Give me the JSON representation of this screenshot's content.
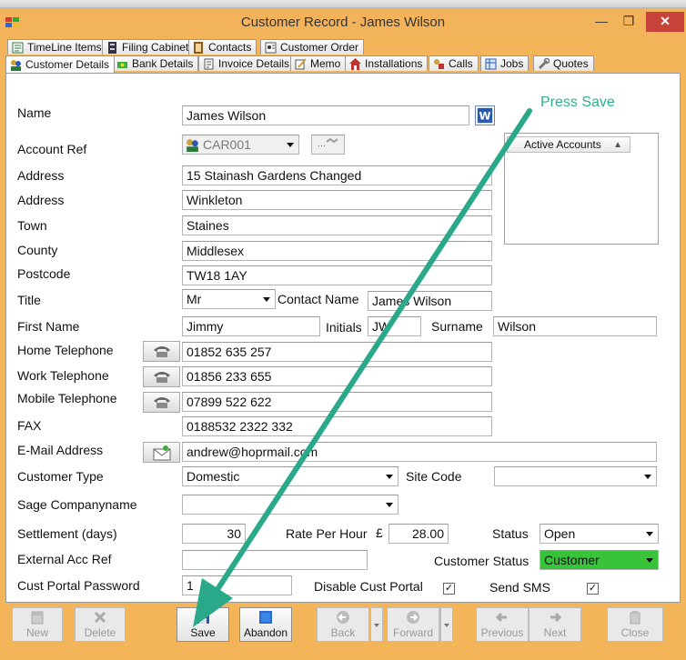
{
  "window": {
    "title": "Customer Record - James Wilson",
    "min_glyph": "—",
    "max_glyph": "❐",
    "close_glyph": "✕"
  },
  "tabs_row1": [
    {
      "label": "TimeLine Items",
      "icon": "timeline-icon"
    },
    {
      "label": "Filing Cabinet",
      "icon": "filing-cabinet-icon"
    },
    {
      "label": "Contacts",
      "icon": "contacts-icon"
    },
    {
      "label": "Customer Order",
      "icon": "customer-order-icon"
    }
  ],
  "tabs_row2": [
    {
      "label": "Customer Details",
      "icon": "customer-details-icon",
      "active": true
    },
    {
      "label": "Bank Details",
      "icon": "bank-details-icon"
    },
    {
      "label": "Invoice Details",
      "icon": "invoice-details-icon"
    },
    {
      "label": "Memo",
      "icon": "memo-icon"
    },
    {
      "label": "Installations",
      "icon": "installations-icon"
    },
    {
      "label": "Calls",
      "icon": "calls-icon"
    },
    {
      "label": "Jobs",
      "icon": "jobs-icon"
    },
    {
      "label": "Quotes",
      "icon": "quotes-icon"
    }
  ],
  "form": {
    "name_label": "Name",
    "name_value": "James Wilson",
    "account_ref_label": "Account Ref",
    "account_ref_value": "CAR001",
    "lookup_button_label": "...",
    "address1_label": "Address",
    "address1_value": "15 Stainash Gardens Changed",
    "address2_label": "Address",
    "address2_value": "Winkleton",
    "town_label": "Town",
    "town_value": "Staines",
    "county_label": "County",
    "county_value": "Middlesex",
    "postcode_label": "Postcode",
    "postcode_value": "TW18 1AY",
    "title_label": "Title",
    "title_value": "Mr",
    "contact_name_label": "Contact Name",
    "contact_name_value": "James Wilson",
    "first_name_label": "First Name",
    "first_name_value": "Jimmy",
    "initials_label": "Initials",
    "initials_value": "JW",
    "surname_label": "Surname",
    "surname_value": "Wilson",
    "home_tel_label": "Home Telephone",
    "home_tel_value": "01852 635 257",
    "work_tel_label": "Work Telephone",
    "work_tel_value": "01856 233 655",
    "mobile_tel_label": "Mobile Telephone",
    "mobile_tel_value": "07899 522 622",
    "fax_label": "FAX",
    "fax_value": "0188532 2322 332",
    "email_label": "E-Mail Address",
    "email_value": "andrew@hoprmail.com",
    "customer_type_label": "Customer  Type",
    "customer_type_value": "Domestic",
    "site_code_label": "Site Code",
    "site_code_value": "",
    "sage_company_label": "Sage Companyname",
    "sage_company_value": "",
    "settlement_label": "Settlement (days)",
    "settlement_value": "30",
    "rate_per_hour_label": "Rate Per Hour",
    "currency_symbol": "£",
    "rate_per_hour_value": "28.00",
    "status_label": "Status",
    "status_value": "Open",
    "external_acc_label": "External Acc Ref",
    "external_acc_value": "",
    "customer_status_label": "Customer Status",
    "customer_status_value": "Customer",
    "customer_status_color": "#38c33a",
    "portal_password_label": "Cust Portal Password",
    "portal_password_value": "1",
    "disable_portal_label": "Disable Cust Portal",
    "disable_portal_checked": true,
    "send_sms_label": "Send SMS",
    "send_sms_checked": true,
    "check_glyph": "✓"
  },
  "accounts": {
    "header": "Active Accounts",
    "sort_glyph": "▲"
  },
  "toolbar": [
    {
      "label": "New",
      "icon": "new-icon",
      "enabled": false
    },
    {
      "label": "Delete",
      "icon": "delete-icon",
      "enabled": false
    },
    {
      "label": "Save",
      "icon": "save-icon",
      "enabled": true
    },
    {
      "label": "Abandon",
      "icon": "abandon-icon",
      "enabled": true
    },
    {
      "label": "Back",
      "icon": "back-icon",
      "enabled": false
    },
    {
      "label": "Forward",
      "icon": "forward-icon",
      "enabled": false
    },
    {
      "label": "Previous",
      "icon": "previous-icon",
      "enabled": false
    },
    {
      "label": "Next",
      "icon": "next-icon",
      "enabled": false
    },
    {
      "label": "Close",
      "icon": "close-icon",
      "enabled": false
    }
  ],
  "annotation": {
    "text": "Press Save",
    "color": "#2fae8f"
  },
  "colors": {
    "window_frame": "#f3b45a",
    "close_button": "#c7433a",
    "status_green": "#38c33a"
  }
}
